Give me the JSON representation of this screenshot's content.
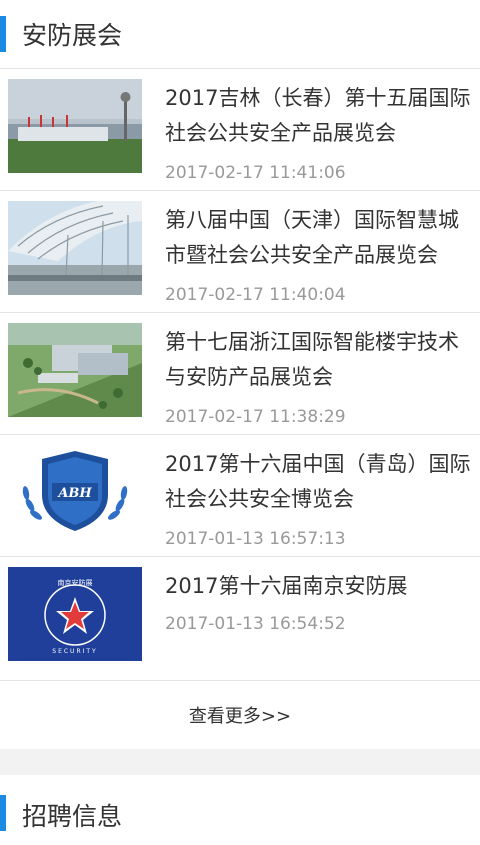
{
  "section1": {
    "title": "安防展会"
  },
  "items": [
    {
      "title": "2017吉林（长春）第十五届国际社会公共安全产品展览会",
      "date": "2017-02-17 11:41:06"
    },
    {
      "title": "第八届中国（天津）国际智慧城市暨社会公共安全产品展览会",
      "date": "2017-02-17 11:40:04"
    },
    {
      "title": "第十七届浙江国际智能楼宇技术与安防产品展览会",
      "date": "2017-02-17 11:38:29"
    },
    {
      "title": "2017第十六届中国（青岛）国际社会公共安全博览会",
      "date": "2017-01-13 16:57:13"
    },
    {
      "title": "2017第十六届南京安防展",
      "date": "2017-01-13 16:54:52"
    }
  ],
  "more_label": "查看更多>>",
  "section2": {
    "title": "招聘信息"
  },
  "thumb_texts": {
    "abh": "ABH",
    "nanjing_top": "南京安防展",
    "nanjing_bottom": "SECURITY"
  },
  "colors": {
    "accent": "#1a8be0",
    "date": "#999999",
    "title": "#333333"
  }
}
